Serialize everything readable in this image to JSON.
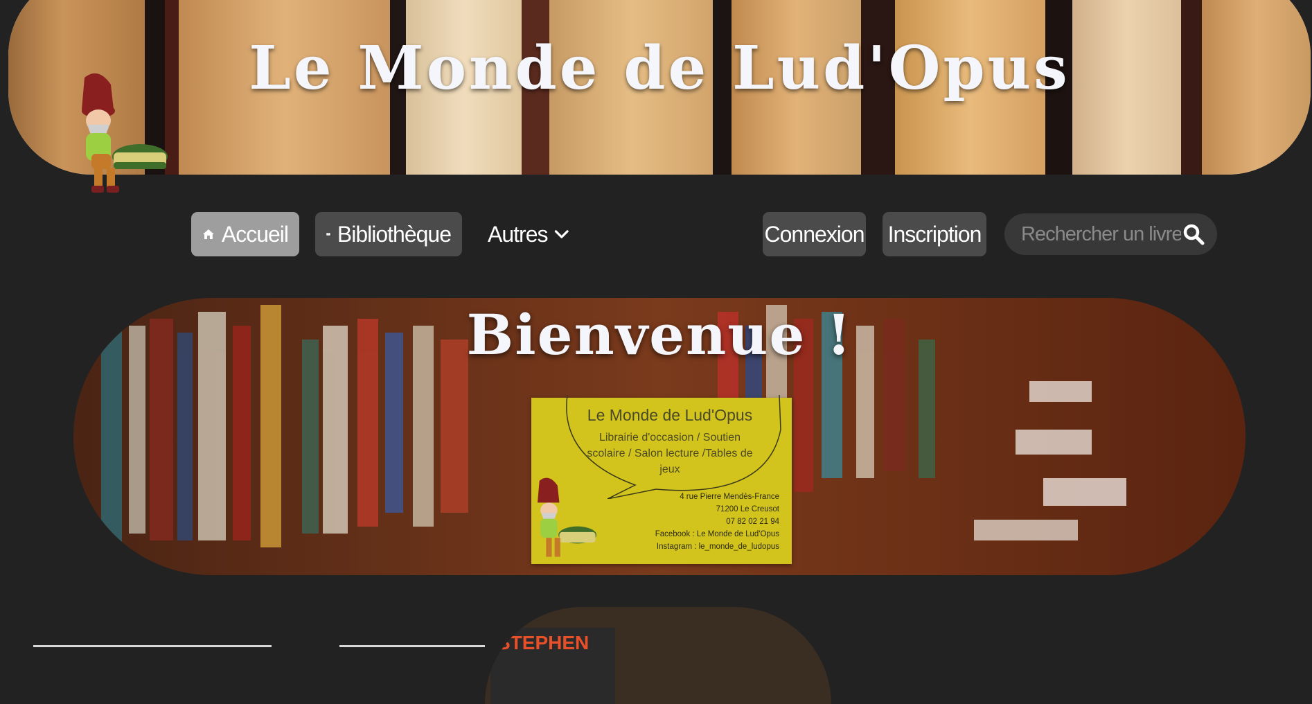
{
  "header": {
    "title": "Le Monde de Lud'Opus"
  },
  "nav": {
    "home": "Accueil",
    "library": "Bibliothèque",
    "other": "Autres",
    "login": "Connexion",
    "signup": "Inscription",
    "search_placeholder": "Rechercher un livre"
  },
  "welcome": {
    "title": "Bienvenue !",
    "card": {
      "name": "Le Monde de Lud'Opus",
      "description": "Librairie d'occasion / Soutien scolaire / Salon lecture /Tables de jeux",
      "address": "4 rue Pierre Mendès-France",
      "city": "71200 Le Creusot",
      "phone": "07 82 02 21 94",
      "facebook": "Facebook : Le Monde de Lud'Opus",
      "instagram": "Instagram : le_monde_de_ludopus"
    }
  },
  "bottom": {
    "book_title_fragment": "STEPHEN"
  },
  "icons": [
    "home-icon",
    "book-open-icon",
    "chevron-down-icon",
    "search-icon"
  ],
  "colors": {
    "background": "#222222",
    "nav_active": "#9e9e9e",
    "nav_button": "#4b4b4b",
    "search_bg": "#383838",
    "card_yellow": "#d2c41d"
  }
}
